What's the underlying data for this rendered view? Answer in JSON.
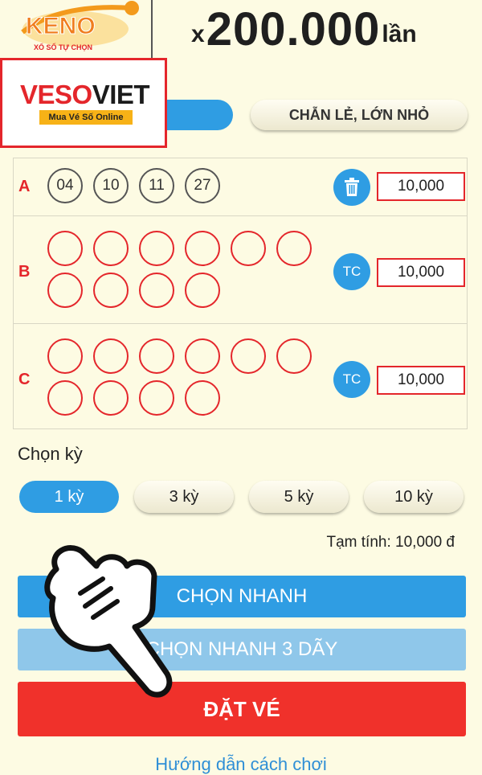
{
  "header": {
    "logo_text": "KENO",
    "logo_sub": "XỔ SỐ TỰ CHỌN",
    "jackpot_prefix": "x",
    "jackpot_amount": "200.000",
    "jackpot_suffix": "lần"
  },
  "brand": {
    "name_red": "VESO",
    "name_black": "VIET",
    "tagline": "Mua Vé Số Online"
  },
  "tabs": {
    "secondary_label": "CHẴN LẺ, LỚN NHỎ"
  },
  "rows": [
    {
      "label": "A",
      "numbers": [
        "04",
        "10",
        "11",
        "27"
      ],
      "amount": "10,000",
      "action": "trash"
    },
    {
      "label": "B",
      "numbers": [],
      "amount": "10,000",
      "action": "TC"
    },
    {
      "label": "C",
      "numbers": [],
      "amount": "10,000",
      "action": "TC"
    }
  ],
  "period": {
    "label": "Chọn kỳ",
    "options": [
      "1 kỳ",
      "3 kỳ",
      "5 kỳ",
      "10 kỳ"
    ],
    "selected": "1 kỳ"
  },
  "subtotal": "Tạm tính: 10,000 đ",
  "buttons": {
    "quick_pick": "CHỌN NHANH",
    "quick_pick_3": "CHỌN NHANH 3 DÃY",
    "order": "ĐẶT VÉ"
  },
  "guide_link": "Hướng dẫn cách chơi",
  "colors": {
    "accent_blue": "#2f9de3",
    "accent_red": "#e4262b",
    "background": "#fdfbe3",
    "order_red": "#f0312b"
  }
}
